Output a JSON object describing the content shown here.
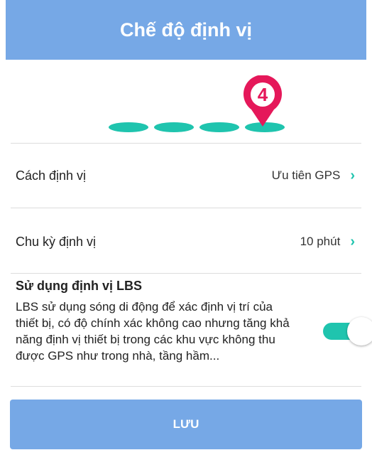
{
  "header": {
    "title": "Chế độ định vị"
  },
  "steps": {
    "current_step": "4",
    "total_steps": 4,
    "accent_color": "#1FC4AE",
    "pin_color": "#E5185A"
  },
  "settings": [
    {
      "label": "Cách định vị",
      "value": "Ưu tiên GPS",
      "icon": "chevron-right-icon"
    },
    {
      "label": "Chu kỳ định vị",
      "value": "10 phút",
      "icon": "chevron-right-icon"
    }
  ],
  "lbs": {
    "title": "Sử dụng định vị LBS",
    "description": "LBS sử dụng sóng di động để xác định vị trí của thiết bị, có độ chính xác không cao nhưng tăng khả năng định vị thiết bị trong các khu vực không thu được GPS như trong nhà, tầng hầm...",
    "enabled": true
  },
  "footer": {
    "save_label": "LƯU"
  },
  "colors": {
    "header_bg": "#76A8E6",
    "accent": "#1FC4AE"
  }
}
